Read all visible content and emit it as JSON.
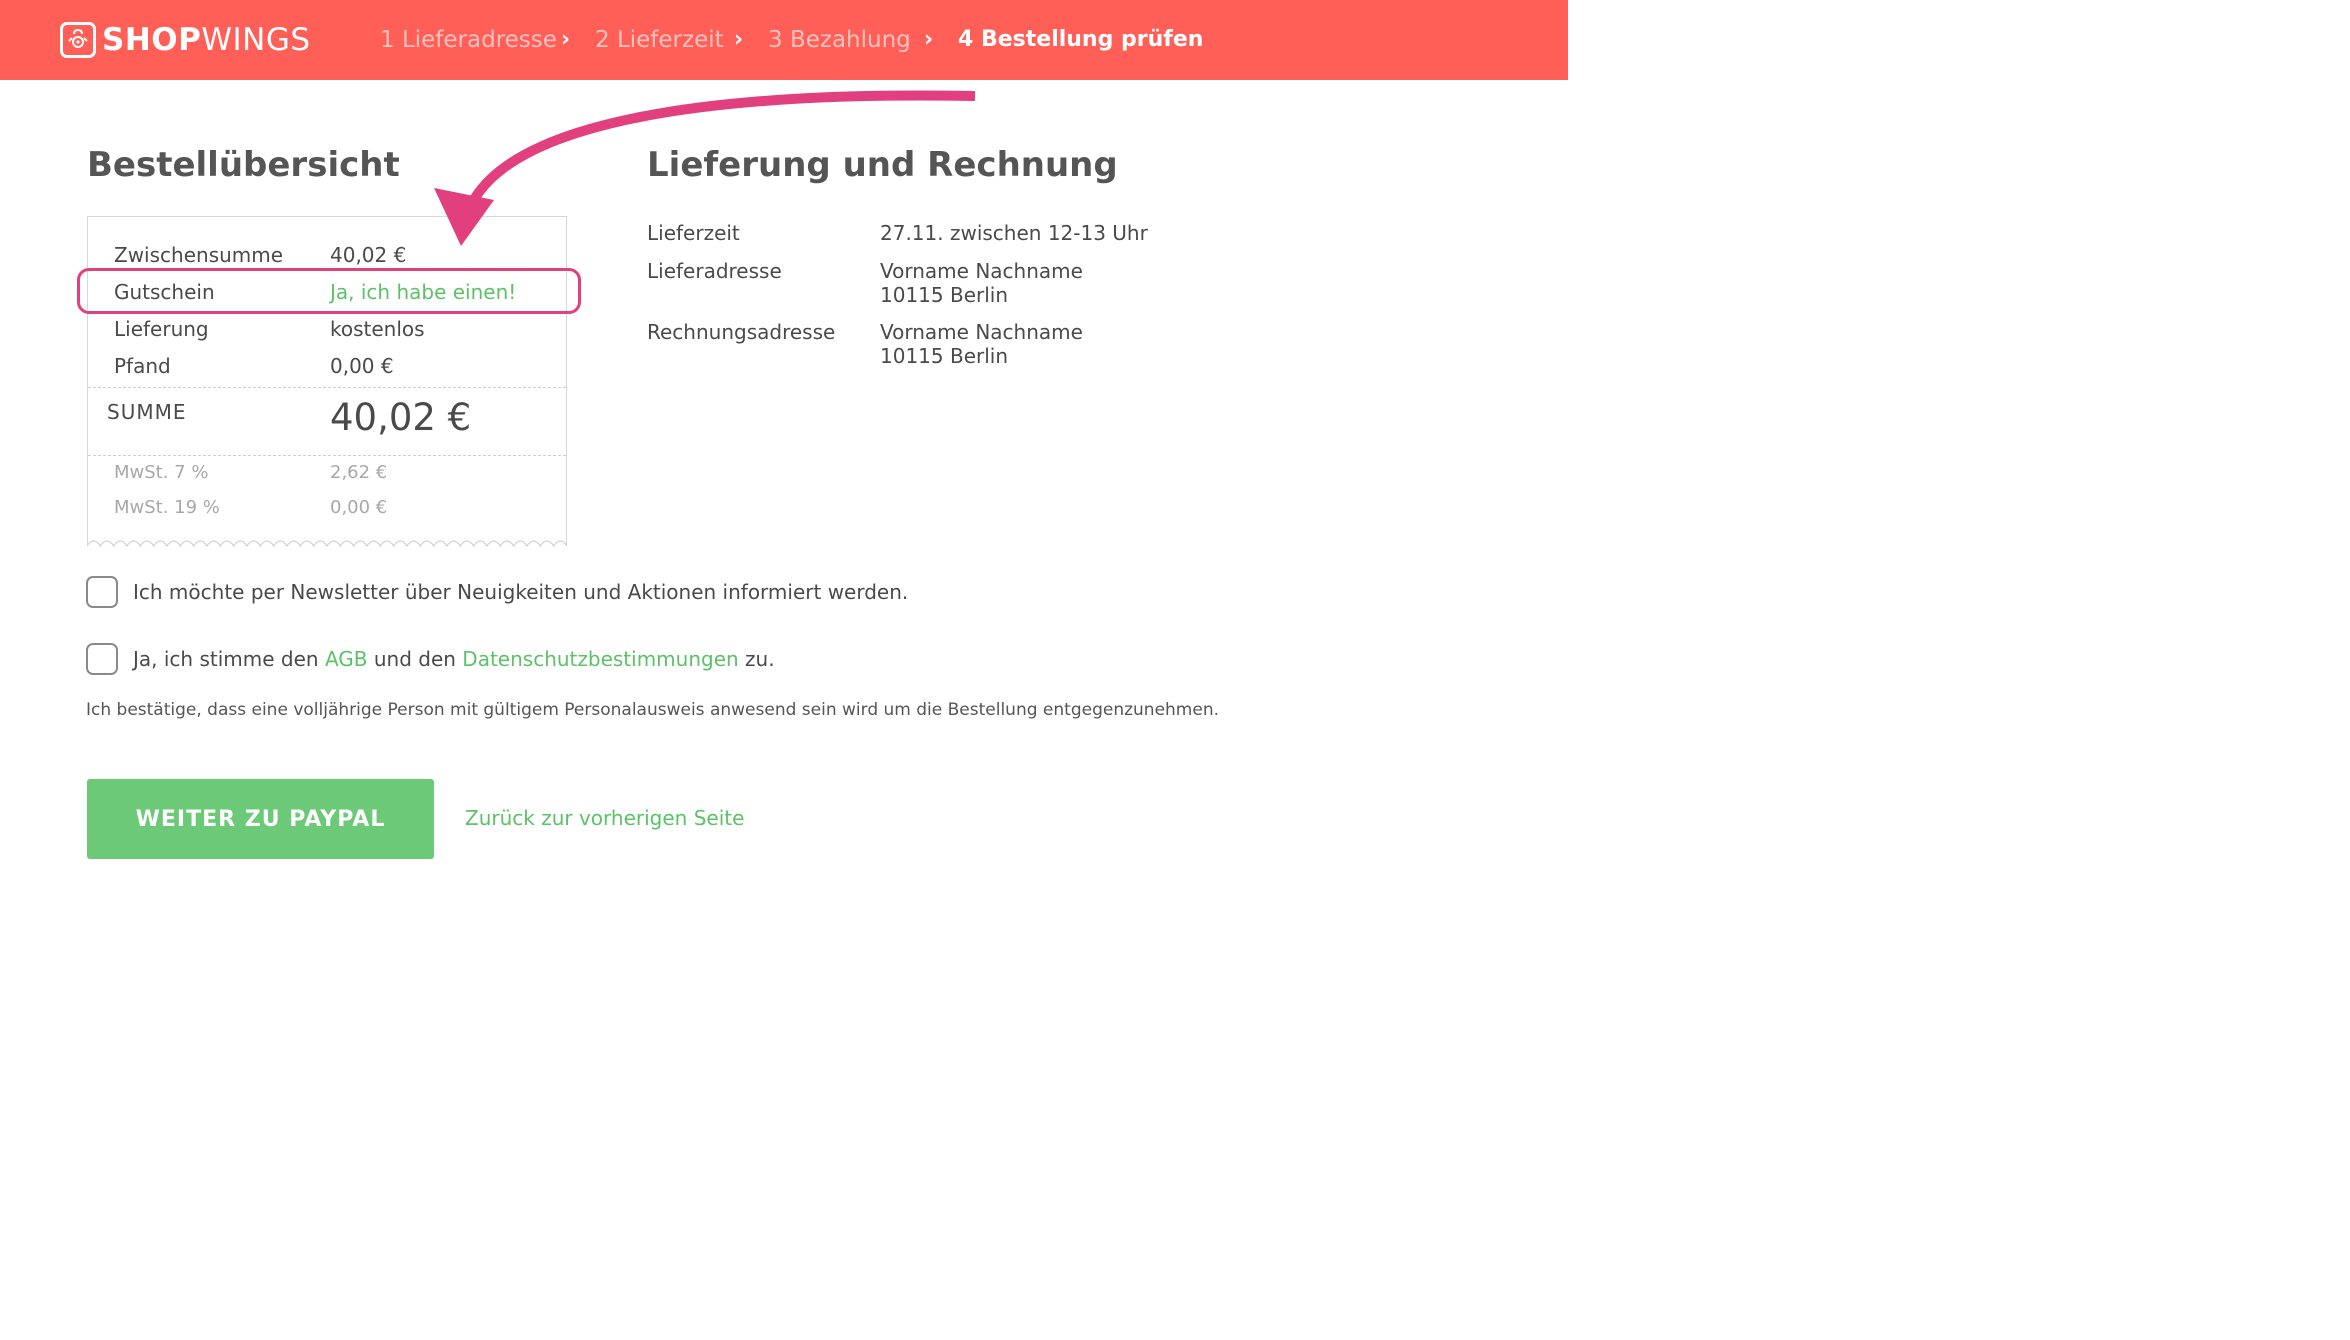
{
  "brand": {
    "name_bold": "SHOP",
    "name_light": "WINGS",
    "color": "#ff5f57"
  },
  "steps": [
    {
      "label": "1 Lieferadresse",
      "state": "done"
    },
    {
      "label": "2 Lieferzeit",
      "state": "done"
    },
    {
      "label": "3 Bezahlung",
      "state": "done"
    },
    {
      "label": "4 Bestellung prüfen",
      "state": "active"
    }
  ],
  "summary": {
    "title": "Bestellübersicht",
    "rows": [
      {
        "label": "Zwischensumme",
        "value": "40,02 €"
      },
      {
        "label": "Gutschein",
        "value": "Ja, ich habe einen!"
      },
      {
        "label": "Lieferung",
        "value": "kostenlos"
      },
      {
        "label": "Pfand",
        "value": "0,00 €"
      }
    ],
    "total_label": "SUMME",
    "total_value": "40,02 €",
    "tax_rows": [
      {
        "label": "MwSt. 7 %",
        "value": "2,62 €"
      },
      {
        "label": "MwSt. 19 %",
        "value": "0,00 €"
      }
    ]
  },
  "delivery": {
    "title": "Lieferung und Rechnung",
    "rows": [
      {
        "label": "Lieferzeit",
        "lines": [
          "27.11. zwischen 12-13 Uhr"
        ]
      },
      {
        "label": "Lieferadresse",
        "lines": [
          "Vorname Nachname",
          "10115 Berlin"
        ]
      },
      {
        "label": "Rechnungsadresse",
        "lines": [
          "Vorname Nachname",
          "10115 Berlin"
        ]
      }
    ]
  },
  "newsletter": {
    "text": "Ich möchte per Newsletter über Neuigkeiten und Aktionen informiert werden.",
    "checked": false
  },
  "terms": {
    "prefix": "Ja, ich stimme den ",
    "agb": "AGB",
    "middle": " und den ",
    "privacy": "Datenschutzbestimmungen",
    "suffix": " zu.",
    "checked": false
  },
  "confirm_text": "Ich bestätige, dass eine volljährige Person mit gültigem Personalausweis anwesend sein wird um die Bestellung entgegenzunehmen.",
  "actions": {
    "primary": "WEITER ZU PAYPAL",
    "back": "Zurück zur vorherigen Seite"
  },
  "colors": {
    "accent_green": "#6cc977",
    "link_green": "#5cc267",
    "highlight_pink": "#e23f7f"
  }
}
